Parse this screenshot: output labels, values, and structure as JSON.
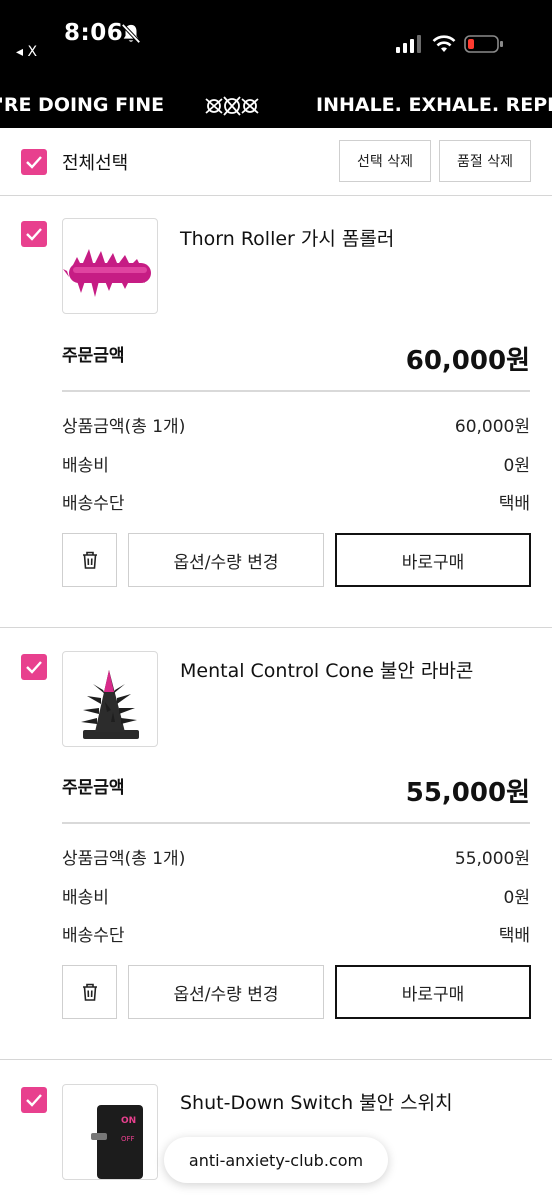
{
  "status_bar": {
    "time": "8:06",
    "back_app": "◂ X"
  },
  "marquee": {
    "left_text": "'RE DOING FINE",
    "right_text": "INHALE. EXHALE. REPEA"
  },
  "cart": {
    "select_all_label": "전체선택",
    "delete_selected_label": "선택 삭제",
    "delete_soldout_label": "품절 삭제",
    "accent_color": "#e8408e"
  },
  "products": [
    {
      "name": "Thorn Roller 가시 폼롤러",
      "order_label": "주문금액",
      "order_amount": "60,000원",
      "rows": [
        {
          "label": "상품금액(총 1개)",
          "value": "60,000원"
        },
        {
          "label": "배송비",
          "value": "0원"
        },
        {
          "label": "배송수단",
          "value": "택배"
        }
      ],
      "option_button": "옵션/수량 변경",
      "buy_button": "바로구매"
    },
    {
      "name": "Mental Control Cone 불안 라바콘",
      "order_label": "주문금액",
      "order_amount": "55,000원",
      "rows": [
        {
          "label": "상품금액(총 1개)",
          "value": "55,000원"
        },
        {
          "label": "배송비",
          "value": "0원"
        },
        {
          "label": "배송수단",
          "value": "택배"
        }
      ],
      "option_button": "옵션/수량 변경",
      "buy_button": "바로구매"
    },
    {
      "name": "Shut-Down Switch 불안 스위치",
      "switch_on": "ON",
      "switch_off": "OFF"
    }
  ],
  "browser": {
    "url": "anti-anxiety-club.com"
  },
  "icons": {
    "status": [
      "bell-slash-icon",
      "cellular-signal-icon",
      "wifi-icon",
      "battery-low-icon"
    ],
    "actions": [
      "checkmark-icon",
      "trash-icon"
    ]
  }
}
